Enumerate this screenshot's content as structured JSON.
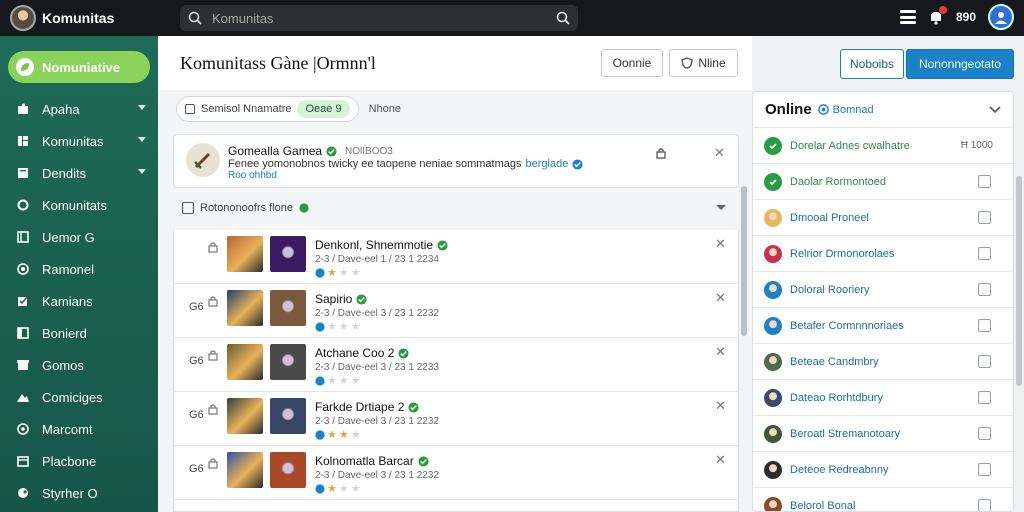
{
  "app": {
    "title": "Komunitas"
  },
  "search": {
    "value": "Komunitas",
    "placeholder": "Komunitas"
  },
  "topbar": {
    "count": "890"
  },
  "sidebar": {
    "cta": "Nomuniative",
    "items": [
      {
        "label": "Apaha",
        "icon": "puzzle-icon",
        "chev": true
      },
      {
        "label": "Komunitas",
        "icon": "grid-icon",
        "chev": true
      },
      {
        "label": "Dendits",
        "icon": "page-icon",
        "chev": true
      },
      {
        "label": "Komunitats",
        "icon": "gear-icon",
        "chev": false
      },
      {
        "label": "Uemor G",
        "icon": "book-icon",
        "chev": false
      },
      {
        "label": "Ramonel",
        "icon": "target-icon",
        "chev": false
      },
      {
        "label": "Kamians",
        "icon": "check-icon",
        "chev": false
      },
      {
        "label": "Bonierd",
        "icon": "board-icon",
        "chev": false
      },
      {
        "label": "Gomos",
        "icon": "store-icon",
        "chev": false
      },
      {
        "label": "Comiciges",
        "icon": "mountain-icon",
        "chev": false
      },
      {
        "label": "Marcomt",
        "icon": "shield-icon",
        "chev": false
      },
      {
        "label": "Placbone",
        "icon": "calendar-icon",
        "chev": false
      },
      {
        "label": "Styrher O",
        "icon": "steam-icon",
        "chev": false
      }
    ]
  },
  "main": {
    "title": "Komunitass Gàne |Ormnn'l",
    "buttons": {
      "b1": "Oonnie",
      "b2": "Nline"
    },
    "filters": {
      "chip_label": "Semisol Nnamatre",
      "chip_active": "Oeae 9",
      "tail": "Nhone"
    },
    "feature": {
      "title": "Gomealla Gamea",
      "code": "NOlIBOO3",
      "desc": "Fenee yomonobnos twicky ee taopene neniae sommatmags",
      "link": "berglade",
      "more": "Roo ohhbd"
    },
    "section": "Rotononoofrs flone",
    "rows": [
      {
        "label": "",
        "name": "Denkonl, Shnemmotie",
        "meta": "2-3 / Dave-eel 1 / 23 1 2234",
        "stars": 1,
        "c1": "#b5652f",
        "c2": "#3b1c63"
      },
      {
        "label": "G6",
        "name": "Sapirio",
        "meta": "2-3 / Dave-eel 3 / 23 1 2232",
        "stars": 0,
        "c1": "#1f3f6d",
        "c2": "#7a5a3c"
      },
      {
        "label": "G6",
        "name": "Atchane Coo 2",
        "meta": "2-3 / Dave-eel 3 / 23 1 2233",
        "stars": 0,
        "c1": "#6b5a2f",
        "c2": "#4a4a4a"
      },
      {
        "label": "G6",
        "name": "Farkde Drtiape 2",
        "meta": "2-3 / Dave-eel 3 / 23 1 2232",
        "stars": 2,
        "c1": "#2f3f3a",
        "c2": "#3a4668"
      },
      {
        "label": "G6",
        "name": "Kolnomatla Barcar",
        "meta": "2-3 / Dave-eel 3 / 23 1 2232",
        "stars": 1,
        "c1": "#2f4fa0",
        "c2": "#a84a2a"
      }
    ]
  },
  "right": {
    "btn1": "Noboibs",
    "btn2": "Nononngeotato",
    "online": "Online",
    "status": "Bomnad",
    "friends": [
      {
        "name": "Dorelar Adnes cwalhatre",
        "green": true,
        "extra": "Ħ 1000"
      },
      {
        "name": "Daolar Rormontoed",
        "green": true
      },
      {
        "name": "Dmooal Proneel",
        "av": "#e7b85a"
      },
      {
        "name": "Relrior Drmonorolaes",
        "av": "#c8324a"
      },
      {
        "name": "Doloral Rooriery",
        "av": "#1a82c8"
      },
      {
        "name": "Betafer Cormnnnoriaes",
        "av": "#1a82c8"
      },
      {
        "name": "Beteae Candmbry",
        "av": "#4d6a4a"
      },
      {
        "name": "Dateao Rorhtdbury",
        "av": "#3a4a6a"
      },
      {
        "name": "Beroatl Stremanotoary",
        "av": "#3a5a38"
      },
      {
        "name": "Deteoe Redreabnny",
        "av": "#2c2c2c"
      },
      {
        "name": "Belorol Bonal",
        "av": "#8a4a2a"
      }
    ]
  }
}
